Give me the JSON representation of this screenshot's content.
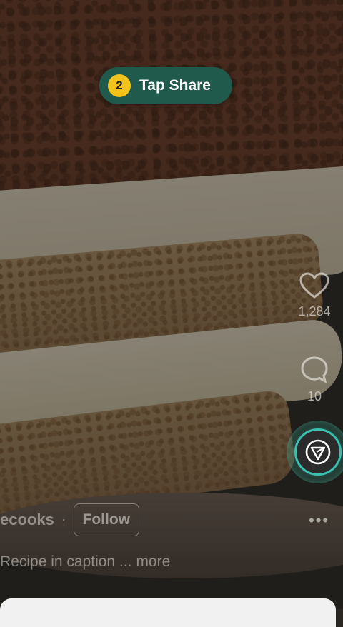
{
  "coach": {
    "step": "2",
    "label": "Tap Share"
  },
  "actions": {
    "like_count": "1,284",
    "comment_count": "10",
    "more_label": "•••"
  },
  "post": {
    "author": "ecooks",
    "separator": "·",
    "follow_label": "Follow",
    "caption": "Recipe in caption ...",
    "caption_more": "more"
  },
  "colors": {
    "coach_bg": "#1f5a4c",
    "step_badge": "#f2c31a",
    "share_highlight": "#39c0b0"
  }
}
